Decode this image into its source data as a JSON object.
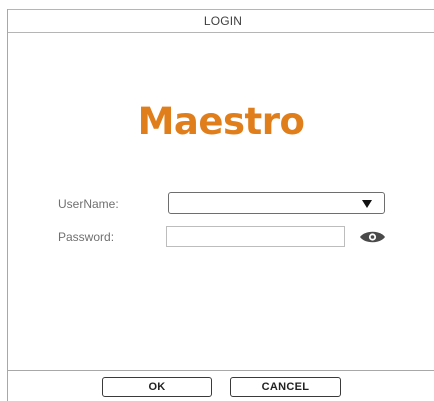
{
  "window": {
    "title": "LOGIN"
  },
  "logo": {
    "text": "Maestro",
    "color": "#e07e1c"
  },
  "form": {
    "username_label": "UserName:",
    "username_value": "",
    "password_label": "Password:",
    "password_value": "",
    "show_password_icon": "eye-icon"
  },
  "buttons": {
    "ok_label": "OK",
    "cancel_label": "CANCEL"
  }
}
